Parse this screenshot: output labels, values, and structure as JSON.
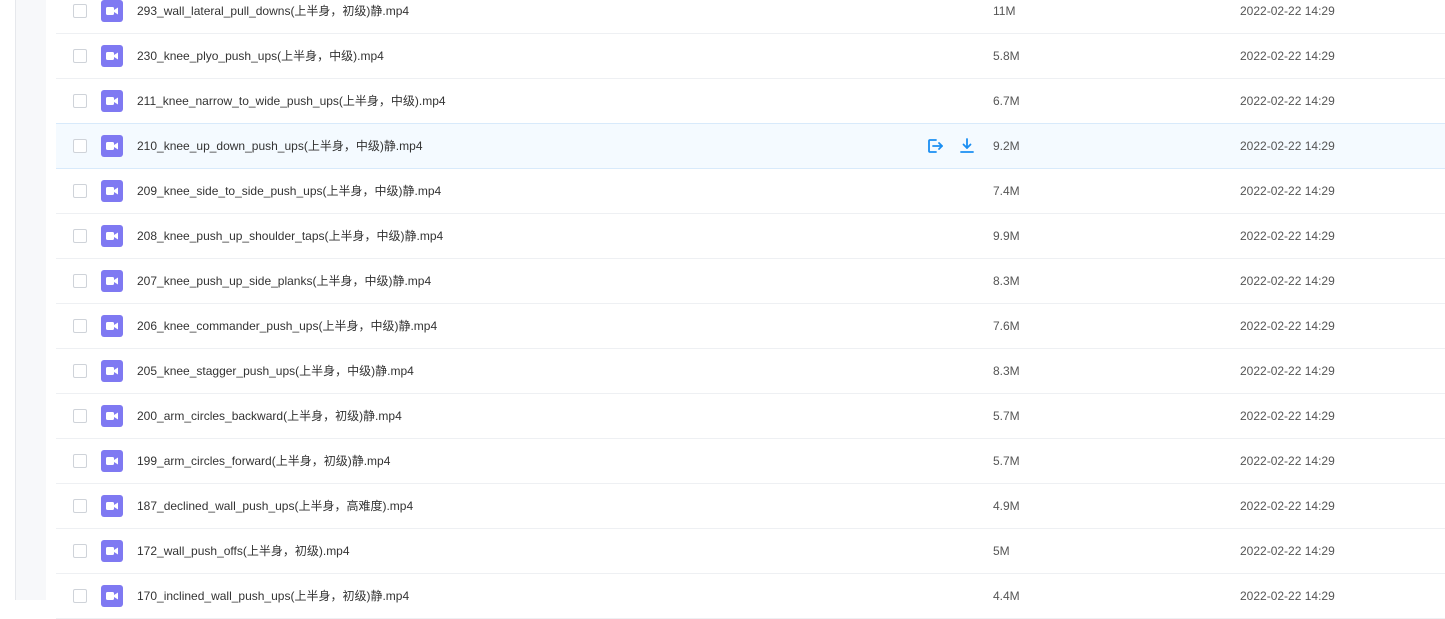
{
  "colors": {
    "file_icon": "#7f79f2",
    "action_icon": "#1a8ef2",
    "hover_row": "#f4faff"
  },
  "icons": {
    "file": "video-file-icon",
    "share": "share-exit-icon",
    "download": "download-icon"
  },
  "files": [
    {
      "name": "293_wall_lateral_pull_downs(上半身，初级)静.mp4",
      "size": "11M",
      "date": "2022-02-22 14:29"
    },
    {
      "name": "230_knee_plyo_push_ups(上半身，中级).mp4",
      "size": "5.8M",
      "date": "2022-02-22 14:29"
    },
    {
      "name": "211_knee_narrow_to_wide_push_ups(上半身，中级).mp4",
      "size": "6.7M",
      "date": "2022-02-22 14:29"
    },
    {
      "name": "210_knee_up_down_push_ups(上半身，中级)静.mp4",
      "size": "9.2M",
      "date": "2022-02-22 14:29",
      "hovered": true
    },
    {
      "name": "209_knee_side_to_side_push_ups(上半身，中级)静.mp4",
      "size": "7.4M",
      "date": "2022-02-22 14:29"
    },
    {
      "name": "208_knee_push_up_shoulder_taps(上半身，中级)静.mp4",
      "size": "9.9M",
      "date": "2022-02-22 14:29"
    },
    {
      "name": "207_knee_push_up_side_planks(上半身，中级)静.mp4",
      "size": "8.3M",
      "date": "2022-02-22 14:29"
    },
    {
      "name": "206_knee_commander_push_ups(上半身，中级)静.mp4",
      "size": "7.6M",
      "date": "2022-02-22 14:29"
    },
    {
      "name": "205_knee_stagger_push_ups(上半身，中级)静.mp4",
      "size": "8.3M",
      "date": "2022-02-22 14:29"
    },
    {
      "name": "200_arm_circles_backward(上半身，初级)静.mp4",
      "size": "5.7M",
      "date": "2022-02-22 14:29"
    },
    {
      "name": "199_arm_circles_forward(上半身，初级)静.mp4",
      "size": "5.7M",
      "date": "2022-02-22 14:29"
    },
    {
      "name": "187_declined_wall_push_ups(上半身，高难度).mp4",
      "size": "4.9M",
      "date": "2022-02-22 14:29"
    },
    {
      "name": "172_wall_push_offs(上半身，初级).mp4",
      "size": "5M",
      "date": "2022-02-22 14:29"
    },
    {
      "name": "170_inclined_wall_push_ups(上半身，初级)静.mp4",
      "size": "4.4M",
      "date": "2022-02-22 14:29"
    }
  ]
}
